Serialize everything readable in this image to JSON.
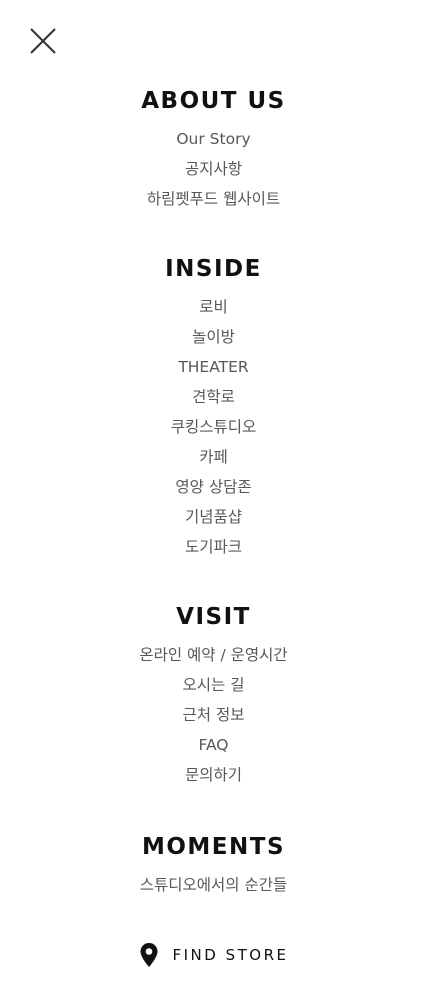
{
  "close": {
    "icon": "close-icon"
  },
  "sections": {
    "about": {
      "title": "ABOUT US",
      "items": [
        "Our Story",
        "공지사항",
        "하림펫푸드 웹사이트"
      ]
    },
    "inside": {
      "title": "INSIDE",
      "items": [
        "로비",
        "놀이방",
        "THEATER",
        "견학로",
        "쿠킹스튜디오",
        "카페",
        "영양 상담존",
        "기념품샵",
        "도기파크"
      ]
    },
    "visit": {
      "title": "VISIT",
      "items": [
        "온라인 예약 /  운영시간",
        "오시는 길",
        "근처 정보",
        "FAQ",
        "문의하기"
      ]
    },
    "moments": {
      "title": "MOMENTS",
      "items": [
        "스튜디오에서의 순간들"
      ]
    }
  },
  "footer": {
    "find_store_label": "FIND STORE",
    "icon": "location-pin-icon"
  },
  "colors": {
    "title": "#111111",
    "item": "#585858",
    "background": "#ffffff"
  }
}
